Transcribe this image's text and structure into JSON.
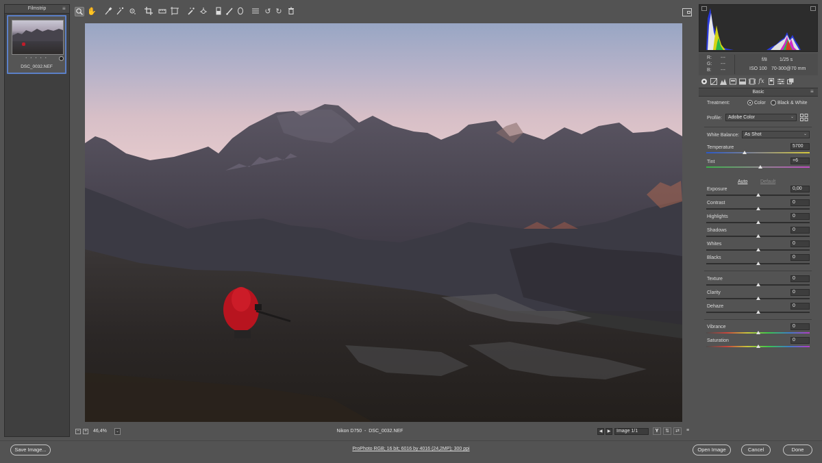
{
  "filmstrip": {
    "title": "Filmstrip",
    "thumbnail": {
      "filename": "DSC_0032.NEF",
      "stars": "• • • • •"
    }
  },
  "toolbar": {
    "tools": [
      "zoom-tool",
      "hand-tool",
      "white-balance-tool",
      "color-sampler-tool",
      "targeted-adjustment-tool",
      "crop-tool",
      "straighten-tool",
      "transform-tool",
      "spot-removal-tool",
      "red-eye-tool",
      "adjustment-brush-tool",
      "graduated-filter-tool",
      "radial-filter-tool",
      "preferences",
      "rotate-left",
      "rotate-right",
      "trash"
    ],
    "active_tool": "zoom-tool"
  },
  "preview": {
    "zoom": "46,4%",
    "camera": "Nikon D750",
    "filename": "DSC_0032.NEF",
    "image_counter": "Image 1/1",
    "view_btn_y": "Y"
  },
  "info": {
    "r_label": "R:",
    "g_label": "G:",
    "b_label": "B:",
    "r_value": "---",
    "g_value": "---",
    "b_value": "---",
    "aperture": "f/8",
    "shutter": "1/25 s",
    "iso": "ISO 100",
    "lens": "70-300@70 mm"
  },
  "panel": {
    "section_title": "Basic",
    "treatment_label": "Treatment:",
    "treatment_color": "Color",
    "treatment_bw": "Black & White",
    "profile_label": "Profile:",
    "profile_value": "Adobe Color",
    "wb_label": "White Balance:",
    "wb_value": "As Shot",
    "auto_label": "Auto",
    "default_label": "Default",
    "sliders": {
      "temperature": {
        "label": "Temperature",
        "value": "5700",
        "pos": 0.37
      },
      "tint": {
        "label": "Tint",
        "value": "+6",
        "pos": 0.52
      },
      "exposure": {
        "label": "Exposure",
        "value": "0,00",
        "pos": 0.5
      },
      "contrast": {
        "label": "Contrast",
        "value": "0",
        "pos": 0.5
      },
      "highlights": {
        "label": "Highlights",
        "value": "0",
        "pos": 0.5
      },
      "shadows": {
        "label": "Shadows",
        "value": "0",
        "pos": 0.5
      },
      "whites": {
        "label": "Whites",
        "value": "0",
        "pos": 0.5
      },
      "blacks": {
        "label": "Blacks",
        "value": "0",
        "pos": 0.5
      },
      "texture": {
        "label": "Texture",
        "value": "0",
        "pos": 0.5
      },
      "clarity": {
        "label": "Clarity",
        "value": "0",
        "pos": 0.5
      },
      "dehaze": {
        "label": "Dehaze",
        "value": "0",
        "pos": 0.5
      },
      "vibrance": {
        "label": "Vibrance",
        "value": "0",
        "pos": 0.5
      },
      "saturation": {
        "label": "Saturation",
        "value": "0",
        "pos": 0.5
      }
    }
  },
  "bottom": {
    "save_label": "Save Image...",
    "workflow": "ProPhoto RGB; 16 bit; 6016 by 4016 (24,2MP); 300 ppi",
    "open_label": "Open Image",
    "cancel_label": "Cancel",
    "done_label": "Done"
  },
  "colors": {
    "accent": "#5b80c8",
    "panel_bg": "#535353",
    "dark_bg": "#3f3f3f"
  }
}
